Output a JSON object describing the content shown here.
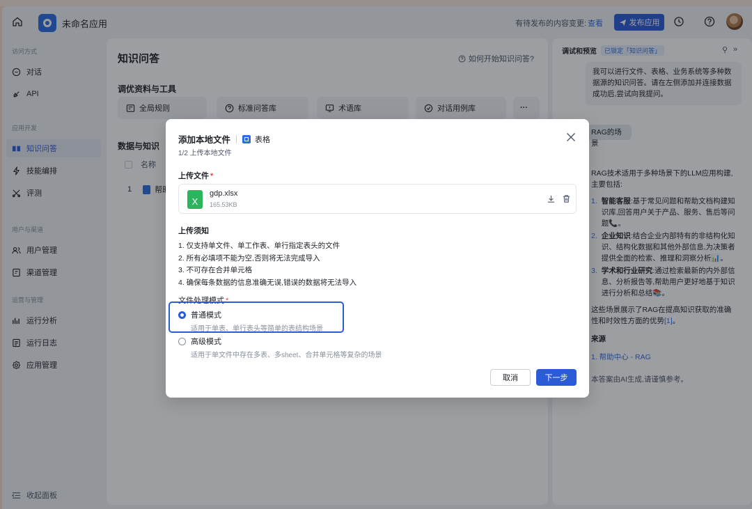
{
  "header": {
    "app_name": "未命名应用",
    "pending_text": "有待发布的内容变更:",
    "pending_link": "查看",
    "publish_label": "发布应用"
  },
  "sidebar": {
    "groups": [
      {
        "label": "访问方式",
        "items": [
          {
            "label": "对话",
            "icon": "chat-icon"
          },
          {
            "label": "API",
            "icon": "api-icon"
          }
        ]
      },
      {
        "label": "应用开发",
        "items": [
          {
            "label": "知识问答",
            "icon": "book-icon",
            "active": true
          },
          {
            "label": "技能编排",
            "icon": "skill-icon"
          },
          {
            "label": "评测",
            "icon": "evaluate-icon"
          }
        ]
      },
      {
        "label": "用户与渠道",
        "items": [
          {
            "label": "用户管理",
            "icon": "users-icon"
          },
          {
            "label": "渠道管理",
            "icon": "channel-icon"
          }
        ]
      },
      {
        "label": "运营与管理",
        "items": [
          {
            "label": "运行分析",
            "icon": "chart-icon"
          },
          {
            "label": "运行日志",
            "icon": "log-icon"
          },
          {
            "label": "应用管理",
            "icon": "settings-icon"
          }
        ]
      }
    ],
    "collapse_label": "收起面板"
  },
  "main": {
    "title": "知识问答",
    "help_link": "如何开始知识问答?",
    "tools_title": "调优资料与工具",
    "tools": [
      "全局规则",
      "标准问答库",
      "术语库",
      "对话用例库"
    ],
    "more": "···",
    "data_title": "数据与知识",
    "table_header": "名称",
    "table_row": {
      "index": "1",
      "name": "帮助"
    }
  },
  "right_panel": {
    "title": "调试和预览",
    "tag": "已锁定「知识问答」",
    "intro": "我可以进行文件、表格、业务系统等多种数据源的知识问答。请在左侧添加并连接数据成功后,尝试向我提问。",
    "user_msg": "RAG的场景",
    "answer_intro": "RAG技术适用于多种场景下的LLM应用构建,主要包括:",
    "answer_items": [
      {
        "num": "1.",
        "title": "智能客服",
        "text": ":基于常见问题和帮助文档构建知识库,回答用户关于产品、服务、售后等问题📞。"
      },
      {
        "num": "2.",
        "title": "企业知识",
        "text": ":结合企业内部特有的非结构化知识、结构化数据和其他外部信息,为决策者提供全面的检索、推理和洞察分析📊。"
      },
      {
        "num": "3.",
        "title": "学术和行业研究",
        "text": ":通过检索最新的内外部信息、分析报告等,帮助用户更好地基于知识进行分析和总结📚。"
      }
    ],
    "answer_outro": "这些场景展示了RAG在提高知识获取的准确性和时效性方面的优势",
    "citation": "[1]",
    "source_title": "来源",
    "source_item": "1.  帮助中心 - RAG",
    "disclaimer": "本答案由AI生成,请谨慎参考。"
  },
  "modal": {
    "title": "添加本地文件",
    "file_type": "表格",
    "step": "1/2 上传本地文件",
    "upload_label": "上传文件",
    "required": "*",
    "file": {
      "name": "gdp.xlsx",
      "size": "165.53KB",
      "icon_letter": "X"
    },
    "notice_title": "上传须知",
    "notices": [
      "1. 仅支持单文件、单工作表、单行指定表头的文件",
      "2. 所有必填项不能为空,否则将无法完成导入",
      "3. 不可存在合并单元格",
      "4. 确保每条数据的信息准确无误,错误的数据将无法导入"
    ],
    "mode_label": "文件处理模式",
    "modes": [
      {
        "title": "普通模式",
        "desc": "适用于单表、单行表头等简单的表结构场景",
        "selected": true
      },
      {
        "title": "高级模式",
        "desc": "适用于单文件中存在多表、多sheet、合并单元格等复杂的场景",
        "selected": false
      }
    ],
    "cancel_label": "取消",
    "next_label": "下一步"
  },
  "colors": {
    "primary": "#2b5bd7",
    "link": "#2b6de5",
    "excel": "#2db55d",
    "overlay": "rgba(20,24,32,0.42)"
  }
}
